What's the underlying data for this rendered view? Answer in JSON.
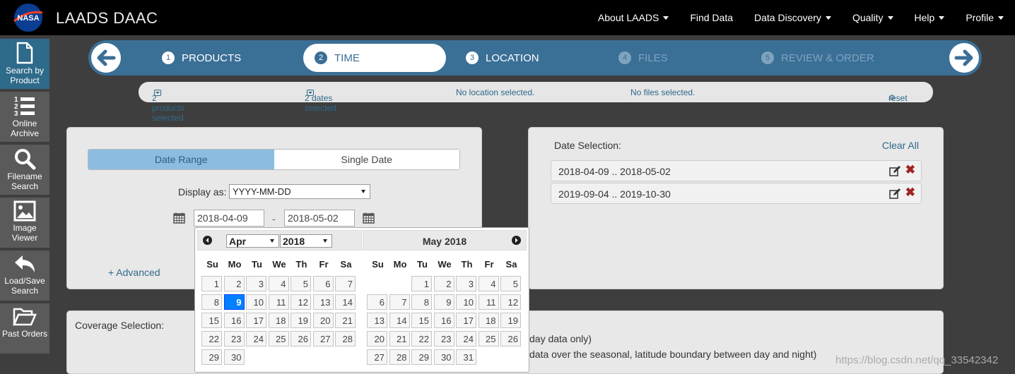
{
  "header": {
    "brand": "LAADS DAAC",
    "logo_text": "NASA",
    "nav": [
      "About LAADS",
      "Find Data",
      "Data Discovery",
      "Quality",
      "Help",
      "Profile"
    ],
    "nav_has_caret": [
      true,
      false,
      true,
      true,
      true,
      true
    ]
  },
  "sidebar": {
    "items": [
      "Search by Product",
      "Online Archive",
      "Filename Search",
      "Image Viewer",
      "Load/Save Search",
      "Past Orders"
    ]
  },
  "wizard": {
    "steps": [
      {
        "num": "1",
        "label": "PRODUCTS"
      },
      {
        "num": "2",
        "label": "TIME"
      },
      {
        "num": "3",
        "label": "LOCATION"
      },
      {
        "num": "4",
        "label": "FILES"
      },
      {
        "num": "5",
        "label": "REVIEW & ORDER"
      }
    ]
  },
  "summary": {
    "products": "2 products selected",
    "dates": "2 dates selected",
    "location": "No location selected.",
    "files": "No files selected.",
    "reset": "reset"
  },
  "date_panel": {
    "tab_range": "Date Range",
    "tab_single": "Single Date",
    "display_as_label": "Display as:",
    "display_as_value": "YYYY-MM-DD",
    "start": "2018-04-09",
    "end": "2018-05-02",
    "dash": "-",
    "advanced": "+ Advanced"
  },
  "selection_panel": {
    "title": "Date Selection:",
    "clear_all": "Clear All",
    "ranges": [
      "2018-04-09 .. 2018-05-02",
      "2019-09-04 .. 2019-10-30"
    ]
  },
  "calendar": {
    "month_select": "Apr",
    "year_select": "2018",
    "second_title": "May 2018",
    "dow": [
      "Su",
      "Mo",
      "Tu",
      "We",
      "Th",
      "Fr",
      "Sa"
    ],
    "selected_day": "9",
    "month1_weeks": [
      [
        "",
        "1",
        "2",
        "3",
        "4",
        "5",
        "6",
        "7"
      ],
      [
        "8",
        "9",
        "10",
        "11",
        "12",
        "13",
        "14"
      ],
      [
        "15",
        "16",
        "17",
        "18",
        "19",
        "20",
        "21"
      ],
      [
        "22",
        "23",
        "24",
        "25",
        "26",
        "27",
        "28"
      ],
      [
        "29",
        "30"
      ]
    ],
    "month2_start_col": 2,
    "month2_days": 31
  },
  "coverage": {
    "title": "Coverage Selection:",
    "line1": "day data only)",
    "line2": "data over the seasonal, latitude boundary between day and night)"
  },
  "watermark": "https://blog.csdn.net/qq_33542342"
}
